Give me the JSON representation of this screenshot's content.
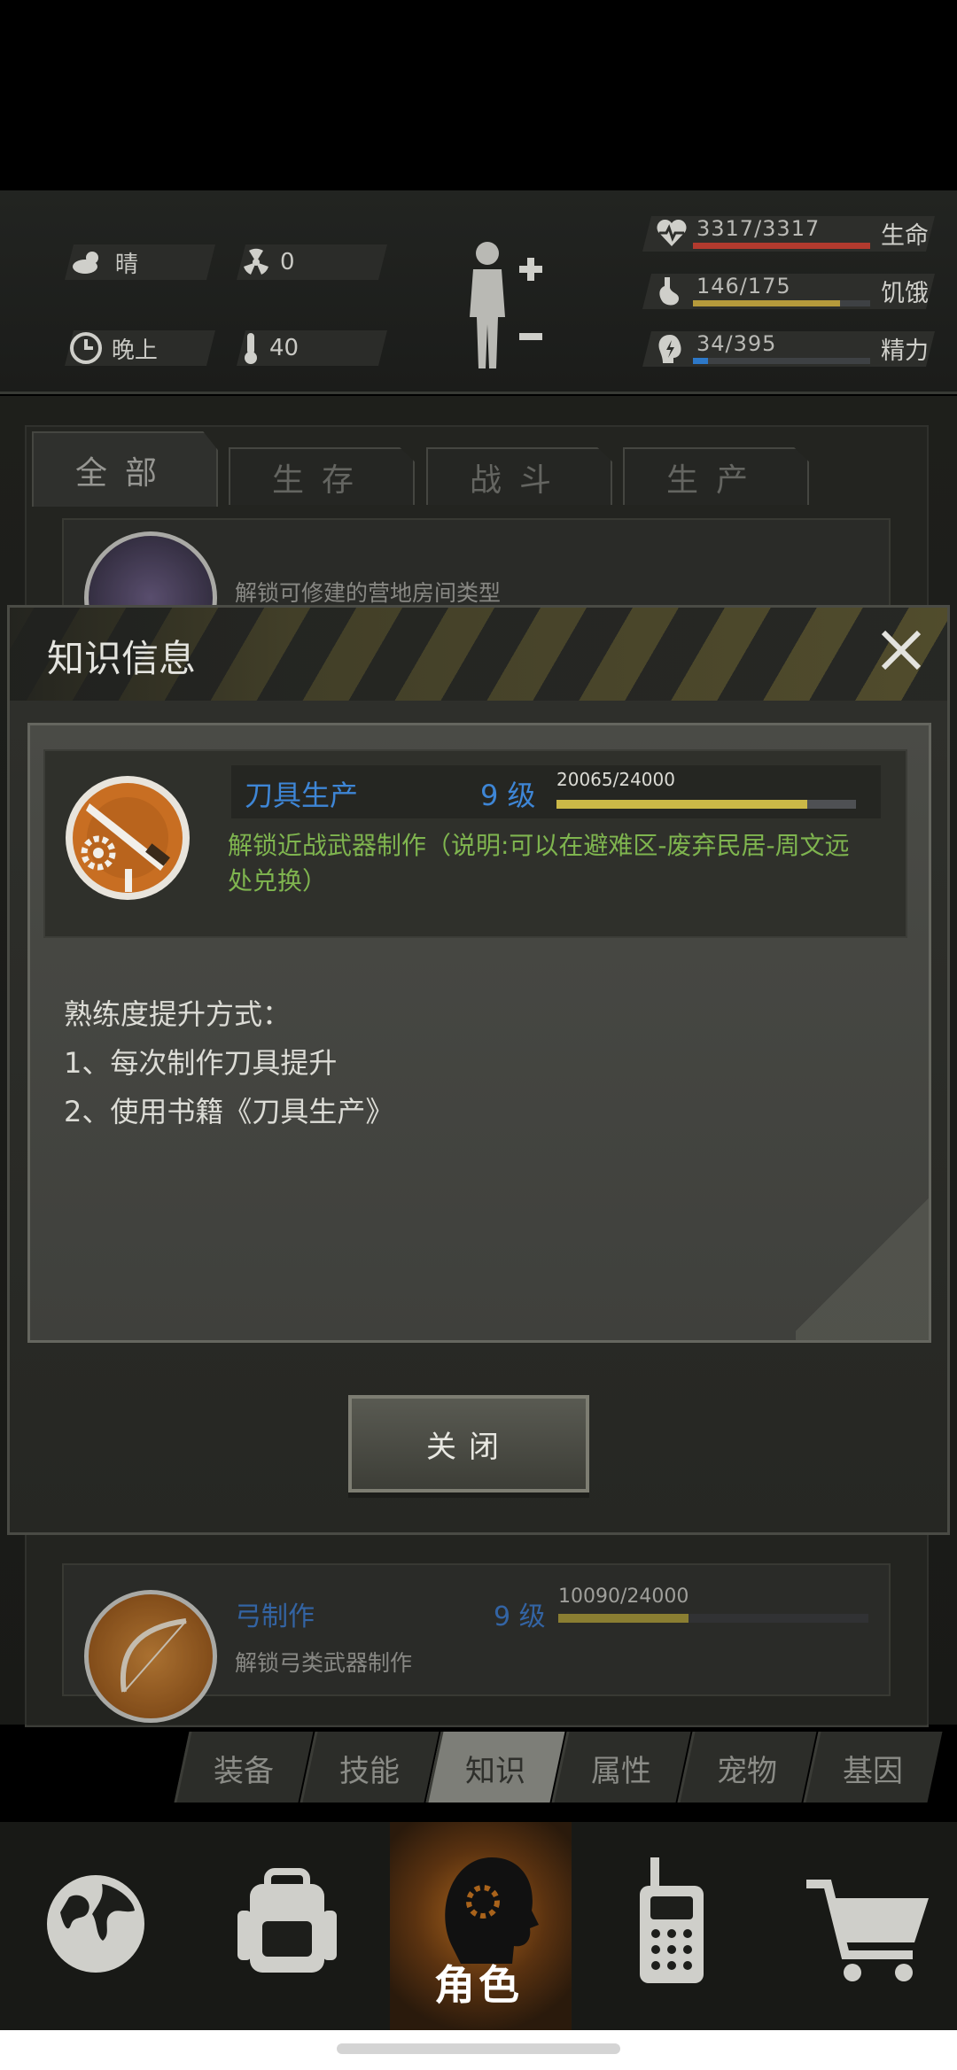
{
  "header": {
    "weather_label": "晴",
    "radiation_value": "0",
    "time_of_day": "晚上",
    "temperature_value": "40",
    "vitals": [
      {
        "id": "health",
        "value": "3317/3317",
        "label": "生命",
        "fraction": 1.0,
        "color": "#b23a2e"
      },
      {
        "id": "hunger",
        "value": "146/175",
        "label": "饥饿",
        "fraction": 0.83,
        "color": "#b59a3b"
      },
      {
        "id": "energy",
        "value": "34/395",
        "label": "精力",
        "fraction": 0.086,
        "color": "#2d78c8"
      }
    ]
  },
  "category_tabs": [
    {
      "label": "全部",
      "active": true
    },
    {
      "label": "生存",
      "active": false
    },
    {
      "label": "战斗",
      "active": false
    },
    {
      "label": "生产",
      "active": false
    }
  ],
  "list_items": [
    {
      "desc": "解锁可修建的营地房间类型"
    },
    {
      "name": "弓制作",
      "level": "9 级",
      "progress_text": "10090/24000",
      "progress": 0.42,
      "desc": "解锁弓类武器制作"
    }
  ],
  "modal": {
    "title": "知识信息",
    "skill": {
      "name": "刀具生产",
      "level": "9 级",
      "progress_text": "20065/24000",
      "progress": 0.836,
      "desc": "解锁近战武器制作（说明:可以在避难区-废弃民居-周文远处兑换）"
    },
    "method_title": "熟练度提升方式：",
    "methods": [
      "1、每次制作刀具提升",
      "2、使用书籍《刀具生产》"
    ],
    "close_button": "关闭"
  },
  "sub_tabs": [
    {
      "label": "装备",
      "active": false
    },
    {
      "label": "技能",
      "active": false
    },
    {
      "label": "知识",
      "active": true
    },
    {
      "label": "属性",
      "active": false
    },
    {
      "label": "宠物",
      "active": false
    },
    {
      "label": "基因",
      "active": false
    }
  ],
  "bottom_nav": [
    {
      "icon": "globe-icon",
      "active": false
    },
    {
      "icon": "backpack-icon",
      "active": false
    },
    {
      "icon": "character-head-icon",
      "label": "角色",
      "active": true
    },
    {
      "icon": "walkie-talkie-icon",
      "active": false
    },
    {
      "icon": "shopping-cart-icon",
      "active": false
    }
  ]
}
